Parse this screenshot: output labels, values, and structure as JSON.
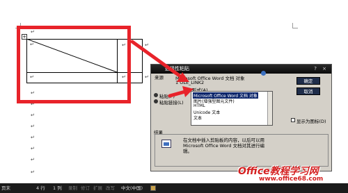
{
  "dialog": {
    "title": "选择性粘贴",
    "source_label": "来源",
    "source_line1": "Microsoft Office Word 文档 对象",
    "source_line2": "1 OLE_LINK2",
    "as_label": "形式(A)",
    "paste_radio": "粘贴(P)",
    "paste_link_radio": "粘贴链接(L)",
    "list_items": [
      "Microsoft Office Word 文档 对象",
      "图片(增强型图元文件)",
      "HTML",
      "Unicode 文本",
      "文本"
    ],
    "ok_button": "确定",
    "cancel_button": "取消",
    "display_as_icon": "显示为图标(D)",
    "result_label": "结果",
    "result_text_line1": "在文档中插入剪贴板的内容，以后可以用",
    "result_text_line2": "Microsoft Office Word 文档对其进行编",
    "result_text_line3": "辑。"
  },
  "statusbar": {
    "page_info": "页末",
    "line": "4 行",
    "column": "1 列",
    "rec": "录制",
    "trk": "修订",
    "ext": "扩展",
    "ovr": "改写",
    "language": "中文(中国)"
  },
  "document": {
    "para_mark": "↵",
    "table_handle": "+"
  },
  "watermark": {
    "line1": "Office教程学习网",
    "line2": "www.office68.com"
  },
  "colors": {
    "highlight": "#e8232a",
    "title_bar": "#111111",
    "selection": "#0a246a"
  }
}
